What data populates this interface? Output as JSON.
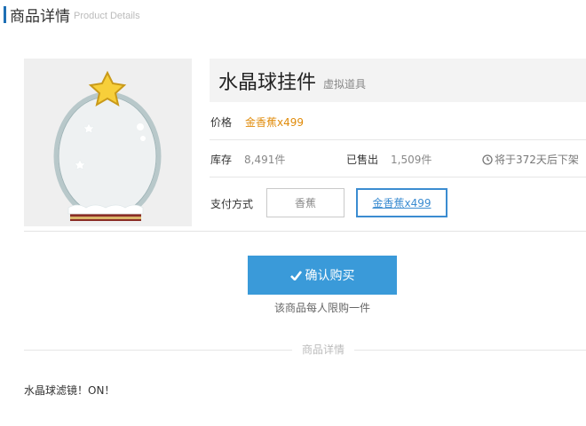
{
  "header": {
    "title": "商品详情",
    "subtitle": "Product Details"
  },
  "product": {
    "name": "水晶球挂件",
    "type_tag": "虚拟道具",
    "price_label": "价格",
    "price_value": "金香蕉x499",
    "stock_label": "库存",
    "stock_value": "8,491件",
    "sold_label": "已售出",
    "sold_value": "1,509件",
    "delist_text": "将于372天后下架",
    "payment_label": "支付方式",
    "payment_options": [
      {
        "label": "香蕉",
        "selected": false
      },
      {
        "label": "金香蕉x499",
        "selected": true
      }
    ]
  },
  "buy": {
    "button_label": "确认购买",
    "limit_note": "该商品每人限购一件"
  },
  "details": {
    "section_label": "商品详情",
    "description": "水晶球滤镜！ON！"
  },
  "icons": {
    "clock": "clock-icon",
    "check": "check-icon",
    "item_image": "crystal-ball-image"
  },
  "colors": {
    "accent": "#3a9ad9",
    "price": "#e08b0a",
    "header_bar": "#1e6fb5"
  }
}
